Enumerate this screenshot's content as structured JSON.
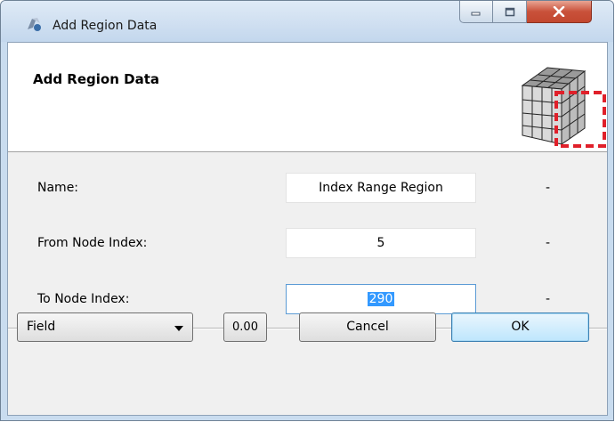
{
  "window": {
    "title": "Add Region Data",
    "controls": {
      "minimize": "minimize-icon",
      "maximize": "maximize-icon",
      "close": "close-icon"
    }
  },
  "header": {
    "title": "Add Region Data",
    "icon": "cube-region-icon",
    "accent_color": "#e0202a"
  },
  "form": {
    "name_label": "Name:",
    "name_value": "Index Range Region",
    "name_status": "-",
    "from_label": "From Node Index:",
    "from_value": "5",
    "from_status": "-",
    "to_label": "To Node Index:",
    "to_value": "290",
    "to_status": "-"
  },
  "footer": {
    "field_select": "Field",
    "value_button": "0.00",
    "cancel_label": "Cancel",
    "ok_label": "OK"
  }
}
